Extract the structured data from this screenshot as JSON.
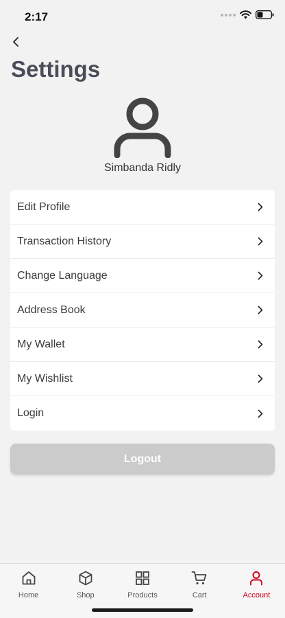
{
  "status_bar": {
    "time": "2:17"
  },
  "header": {
    "title": "Settings"
  },
  "profile": {
    "name": "Simbanda Ridly"
  },
  "menu": {
    "items": [
      {
        "label": "Edit Profile"
      },
      {
        "label": "Transaction History"
      },
      {
        "label": "Change Language"
      },
      {
        "label": "Address Book"
      },
      {
        "label": "My Wallet"
      },
      {
        "label": "My Wishlist"
      },
      {
        "label": "Login"
      }
    ]
  },
  "logout": {
    "label": "Logout"
  },
  "tab_bar": {
    "tabs": [
      {
        "label": "Home",
        "icon": "home-icon"
      },
      {
        "label": "Shop",
        "icon": "box-icon"
      },
      {
        "label": "Products",
        "icon": "grid-icon"
      },
      {
        "label": "Cart",
        "icon": "cart-icon"
      },
      {
        "label": "Account",
        "icon": "user-icon"
      }
    ],
    "active": "Account",
    "accent_color": "#d0021b"
  }
}
